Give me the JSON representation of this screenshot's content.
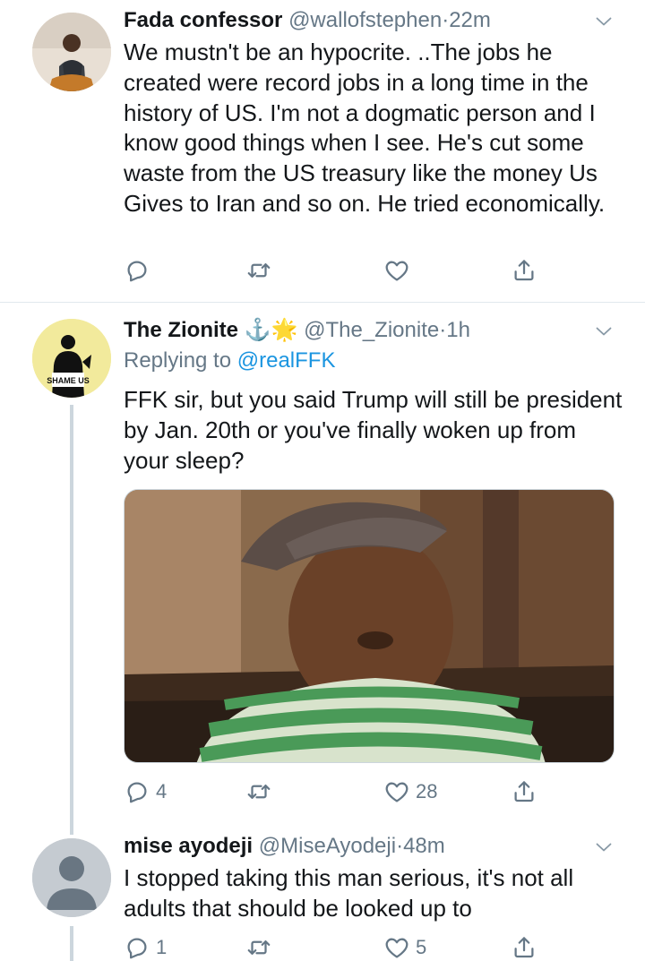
{
  "tweets": [
    {
      "name": "Fada confessor",
      "handle": "@wallofstephen",
      "sep": "·",
      "time": "22m",
      "text": "We mustn't be an hypocrite. ..The jobs he created were record jobs in a long time in the history of US. I'm not a dogmatic person and I know good things when I see. He's cut some waste from the US treasury like the money Us Gives to Iran and so on. He tried economically.",
      "replies": "",
      "likes": ""
    },
    {
      "name": "The Zionite",
      "name_emoji": "⚓🌟",
      "handle": "@The_Zionite",
      "sep": "·",
      "time": "1h",
      "replying_prefix": "Replying to",
      "replying_to": "@realFFK",
      "text": "FFK sir, but you said Trump will still be president by Jan. 20th or you've finally woken up from your sleep?",
      "avatar_caption": "SHAME US",
      "replies": "4",
      "likes": "28"
    },
    {
      "name": "mise ayodeji",
      "handle": "@MiseAyodeji",
      "sep": "·",
      "time": "48m",
      "text": "I stopped taking this man serious, it's not all adults that should be looked up to",
      "replies": "1",
      "likes": "5"
    }
  ],
  "icons": {
    "reply": "reply-icon",
    "retweet": "retweet-icon",
    "like": "heart-icon",
    "share": "share-icon",
    "more": "chevron-down-icon"
  },
  "colors": {
    "text": "#14171a",
    "secondary": "#657786",
    "link": "#1b95e0",
    "divider": "#e1e8ed"
  }
}
